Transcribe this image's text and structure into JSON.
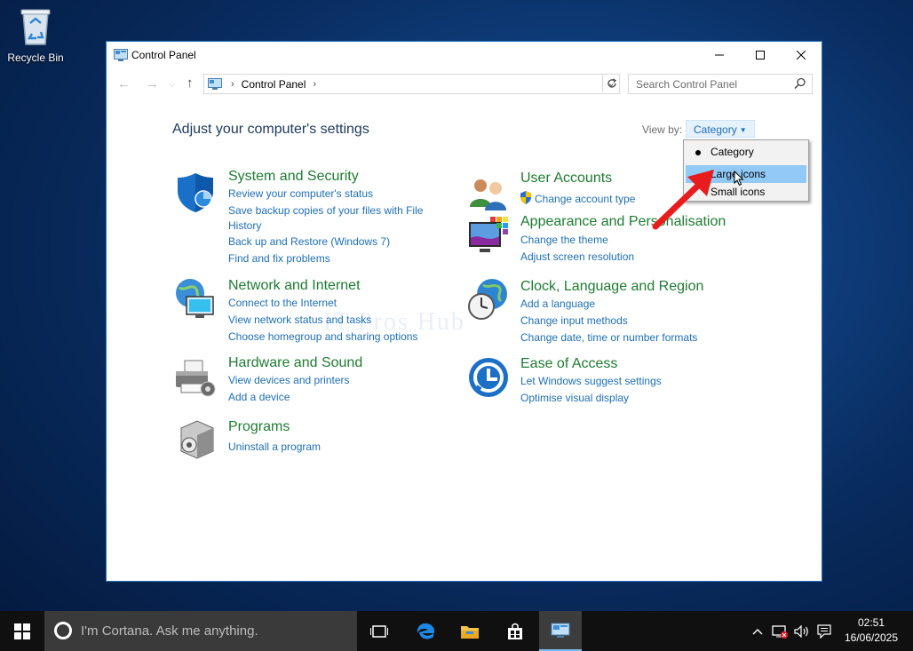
{
  "desktop": {
    "recycle_bin_label": "Recycle Bin"
  },
  "window": {
    "title": "Control Panel",
    "address": {
      "crumb": "Control Panel"
    },
    "search_placeholder": "Search Control Panel",
    "heading": "Adjust your computer's settings",
    "view_by_label": "View by:",
    "view_by_value": "Category",
    "watermark": "IT Pros Hub",
    "categories": [
      {
        "title": "System and Security",
        "links": [
          "Review your computer's status",
          "Save backup copies of your files with File",
          "History",
          "Back up and Restore (Windows 7)",
          "Find and fix problems"
        ]
      },
      {
        "title": "Network and Internet",
        "links": [
          "Connect to the Internet",
          "View network status and tasks",
          "Choose homegroup and sharing options"
        ]
      },
      {
        "title": "Hardware and Sound",
        "links": [
          "View devices and printers",
          "Add a device"
        ]
      },
      {
        "title": "Programs",
        "links": [
          "Uninstall a program"
        ]
      },
      {
        "title": "User Accounts",
        "links": [
          "Change account type"
        ]
      },
      {
        "title": "Appearance and Personalisation",
        "links": [
          "Change the theme",
          "Adjust screen resolution"
        ]
      },
      {
        "title": "Clock, Language and Region",
        "links": [
          "Add a language",
          "Change input methods",
          "Change date, time or number formats"
        ]
      },
      {
        "title": "Ease of Access",
        "links": [
          "Let Windows suggest settings",
          "Optimise visual display"
        ]
      }
    ]
  },
  "view_menu": {
    "items": [
      "Category",
      "Large icons",
      "Small icons"
    ],
    "selected": "Category",
    "highlighted": "Large icons"
  },
  "taskbar": {
    "cortana_placeholder": "I'm Cortana. Ask me anything.",
    "time": "02:51",
    "date": "16/06/2025"
  },
  "colors": {
    "category_title": "#1e7b32",
    "link": "#1e6fb4",
    "heading": "#1e395b",
    "menu_highlight": "#91c9f7",
    "annotation_arrow": "#e81c1c"
  }
}
